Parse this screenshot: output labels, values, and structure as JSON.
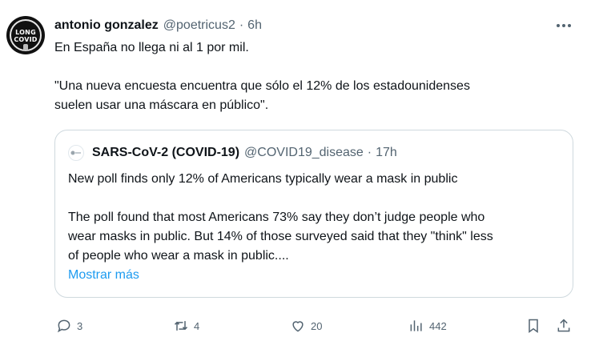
{
  "tweet": {
    "avatar": {
      "line1": "LONG",
      "line2": "COVID"
    },
    "author_name": "antonio gonzalez",
    "handle": "@poetricus2",
    "separator": "·",
    "time": "6h",
    "text_line1": "En España no llega ni al 1 por mil.",
    "text_line2": "\"Una nueva encuesta encuentra que sólo el 12% de los estadounidenses",
    "text_line3": "suelen usar una máscara en público\".",
    "more_icon": "more-horizontal-icon"
  },
  "quote": {
    "author_name": "SARS-CoV-2 (COVID-19)",
    "handle": "@COVID19_disease",
    "separator": "·",
    "time": "17h",
    "line1": "New poll finds only 12% of Americans typically wear a mask in public",
    "line2": "The poll found that most Americans 73% say they don’t judge people who",
    "line3": "wear masks in public. But 14% of those surveyed said that they \"think\" less",
    "line4": "of people who wear a mask in public....",
    "show_more": "Mostrar más"
  },
  "actions": {
    "replies": "3",
    "retweets": "4",
    "likes": "20",
    "views": "442"
  },
  "colors": {
    "text": "#0f1419",
    "secondary": "#536471",
    "link": "#1d9bf0",
    "border": "#cfd9de"
  }
}
